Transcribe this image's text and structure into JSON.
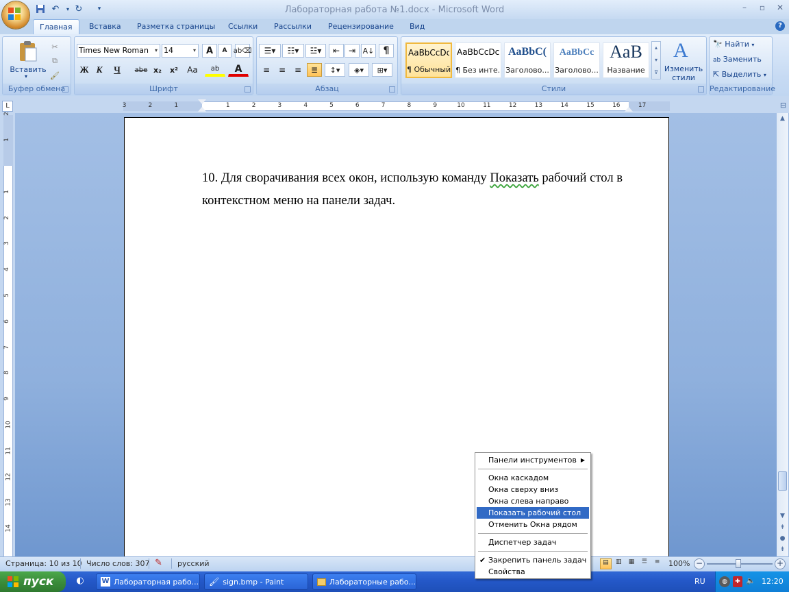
{
  "window": {
    "title": "Лабораторная работа №1.docx - Microsoft Word",
    "minimize": "–",
    "maximize": "▫",
    "close": "✕"
  },
  "qat": {
    "save_icon": "save-icon",
    "undo_icon": "undo-icon",
    "redo_icon": "redo-icon"
  },
  "tabs": [
    {
      "label": "Главная",
      "active": true
    },
    {
      "label": "Вставка"
    },
    {
      "label": "Разметка страницы"
    },
    {
      "label": "Ссылки"
    },
    {
      "label": "Рассылки"
    },
    {
      "label": "Рецензирование"
    },
    {
      "label": "Вид"
    }
  ],
  "help": "?",
  "ribbon": {
    "clipboard": {
      "label": "Буфер обмена",
      "paste": "Вставить"
    },
    "font": {
      "label": "Шрифт",
      "family": "Times New Roman",
      "size": "14",
      "grow": "A",
      "shrink": "A",
      "bold": "Ж",
      "italic": "К",
      "underline": "Ч",
      "strike": "abe",
      "sub": "x₂",
      "sup": "x²",
      "case": "Aa",
      "highlight": "ab",
      "color": "A"
    },
    "paragraph": {
      "label": "Абзац",
      "pilcrow": "¶"
    },
    "styles": {
      "label": "Стили",
      "items": [
        {
          "sample": "AaBbCcDc",
          "name": "¶ Обычный",
          "selected": true
        },
        {
          "sample": "AaBbCcDc",
          "name": "¶ Без инте..."
        },
        {
          "sample": "AaBbC(",
          "name": "Заголово..."
        },
        {
          "sample": "AaBbCc",
          "name": "Заголово..."
        },
        {
          "sample": "AaB",
          "name": "Название"
        }
      ],
      "change_line1": "Изменить",
      "change_line2": "стили"
    },
    "editing": {
      "label": "Редактирование",
      "find": "Найти",
      "replace": "Заменить",
      "select": "Выделить"
    }
  },
  "ruler": {
    "h_labels": [
      "3",
      "2",
      "1",
      "1",
      "2",
      "3",
      "4",
      "5",
      "6",
      "7",
      "8",
      "9",
      "10",
      "11",
      "12",
      "13",
      "14",
      "15",
      "16",
      "17"
    ],
    "v_labels": [
      "2",
      "1",
      "1",
      "2",
      "3",
      "4",
      "5",
      "6",
      "7",
      "8",
      "9",
      "10",
      "11",
      "12",
      "13",
      "14"
    ]
  },
  "document": {
    "line1_before": "10. Для сворачивания всех окон, использую команду ",
    "line1_squiggle": "Показать",
    "line1_after": " рабочий стол в",
    "line2": "контекстном меню на панели задач."
  },
  "context_menu": {
    "toolbars": "Панели инструментов",
    "cascade": "Окна каскадом",
    "top_to_bottom": "Окна сверху вниз",
    "left_to_right": "Окна слева направо",
    "show_desktop": "Показать рабочий стол",
    "undo_side_by_side": "Отменить Окна рядом",
    "task_manager": "Диспетчер задач",
    "lock_taskbar": "Закрепить панель задач",
    "properties": "Свойства"
  },
  "status": {
    "page": "Страница: 10 из 10",
    "words": "Число слов: 307",
    "language": "русский",
    "zoom": "100%"
  },
  "taskbar": {
    "start": "пуск",
    "items": [
      {
        "label": "Лабораторная рабо...",
        "icon": "word-doc-icon"
      },
      {
        "label": "sign.bmp - Paint",
        "icon": "paint-icon"
      },
      {
        "label": "Лабораторные рабо...",
        "icon": "folder-icon"
      }
    ],
    "lang": "RU",
    "clock": "12:20"
  }
}
